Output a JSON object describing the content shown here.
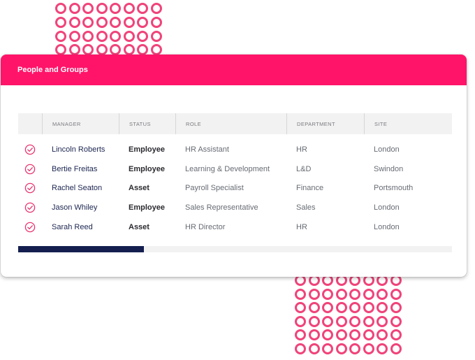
{
  "panel": {
    "title": "People and Groups",
    "header_color": "#ff1469"
  },
  "table": {
    "columns": [
      "MANAGER",
      "STATUS",
      "ROLE",
      "DEPARTMENT",
      "SITE"
    ],
    "rows": [
      {
        "manager": "Lincoln Roberts",
        "status": "Employee",
        "role": "HR Assistant",
        "department": "HR",
        "site": "London"
      },
      {
        "manager": "Bertie Freitas",
        "status": "Employee",
        "role": "Learning & Development",
        "department": "L&D",
        "site": "Swindon"
      },
      {
        "manager": "Rachel Seaton",
        "status": "Asset",
        "role": "Payroll Specialist",
        "department": "Finance",
        "site": "Portsmouth"
      },
      {
        "manager": "Jason Whiley",
        "status": "Employee",
        "role": "Sales Representative",
        "department": "Sales",
        "site": "London"
      },
      {
        "manager": "Sarah Reed",
        "status": "Asset",
        "role": "HR Director",
        "department": "HR",
        "site": "London"
      }
    ],
    "row_icon": "check-circle-icon",
    "accent_color": "#e8336d"
  },
  "scrollbar": {
    "position_fraction": 0.29,
    "thumb_color": "#141f4f"
  }
}
